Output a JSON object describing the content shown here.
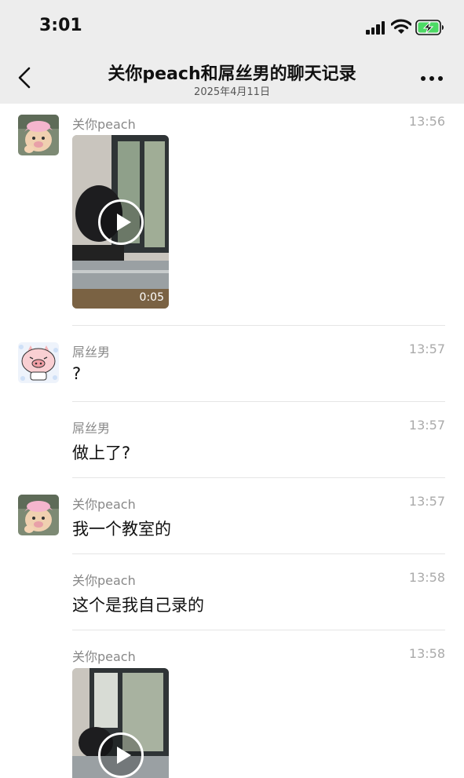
{
  "status_bar": {
    "time": "3:01",
    "signal_icon": "cellular-signal-icon",
    "wifi_icon": "wifi-icon",
    "battery_icon": "battery-charging-icon",
    "battery_color": "#4cd964"
  },
  "header": {
    "back_icon": "chevron-left-icon",
    "title": "关你peach和屌丝男的聊天记录",
    "subtitle": "2025年4月11日",
    "more_icon": "more-dots-icon"
  },
  "messages": [
    {
      "sender": "关你peach",
      "time": "13:56",
      "type": "video",
      "duration": "0:05",
      "avatar": "pink-cartoon-avatar"
    },
    {
      "sender": "屌丝男",
      "time": "13:57",
      "type": "text",
      "text": "?",
      "avatar": "pig-cartoon-avatar"
    },
    {
      "sender": "屌丝男",
      "time": "13:57",
      "type": "text",
      "text": "做上了?"
    },
    {
      "sender": "关你peach",
      "time": "13:57",
      "type": "text",
      "text": "我一个教室的",
      "avatar": "pink-cartoon-avatar"
    },
    {
      "sender": "关你peach",
      "time": "13:58",
      "type": "text",
      "text": "这个是我自己录的"
    },
    {
      "sender": "关你peach",
      "time": "13:58",
      "type": "video",
      "duration": "",
      "avatar": ""
    }
  ]
}
